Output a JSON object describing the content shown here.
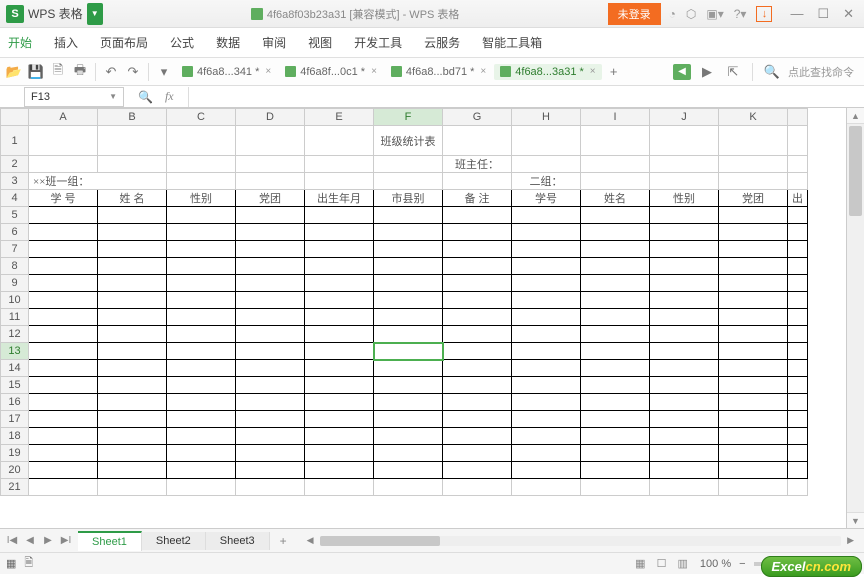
{
  "title": {
    "app_logo": "S",
    "app_name": "WPS 表格",
    "document": "4f6a8f03b23a31 [兼容模式] - WPS 表格",
    "unlogged": "未登录"
  },
  "window_controls": {
    "min": "—",
    "max": "☐",
    "close": "✕"
  },
  "menu": {
    "start": "开始",
    "insert": "插入",
    "layout": "页面布局",
    "formula": "公式",
    "data": "数据",
    "review": "审阅",
    "view": "视图",
    "dev": "开发工具",
    "cloud": "云服务",
    "smart": "智能工具箱"
  },
  "doc_tabs": {
    "t1": "4f6a8...341 *",
    "t2": "4f6a8f...0c1 *",
    "t3": "4f6a8...bd71 *",
    "t4": "4f6a8...3a31 *"
  },
  "toolbar_right": {
    "search_placeholder": "点此查找命令"
  },
  "formula": {
    "name_box": "F13"
  },
  "columns": [
    "A",
    "B",
    "C",
    "D",
    "E",
    "F",
    "G",
    "H",
    "I",
    "J",
    "K"
  ],
  "rows_visible": 21,
  "active_cell": {
    "row": 13,
    "col": "F"
  },
  "sheet": {
    "title": "班级统计表",
    "row2_class": "××班一组：",
    "row2_headteacher": "班主任：",
    "row2_group2": "二组：",
    "headers": [
      "学 号",
      "姓 名",
      "性别",
      "党团",
      "出生年月",
      "市县别",
      "备 注",
      "学号",
      "姓名",
      "性别",
      "党团"
    ],
    "header_overflow": "出"
  },
  "sheet_tabs": {
    "s1": "Sheet1",
    "s2": "Sheet2",
    "s3": "Sheet3"
  },
  "status": {
    "zoom": "100 %"
  },
  "watermark": {
    "brand": "Excel",
    "domain": "cn.com"
  }
}
